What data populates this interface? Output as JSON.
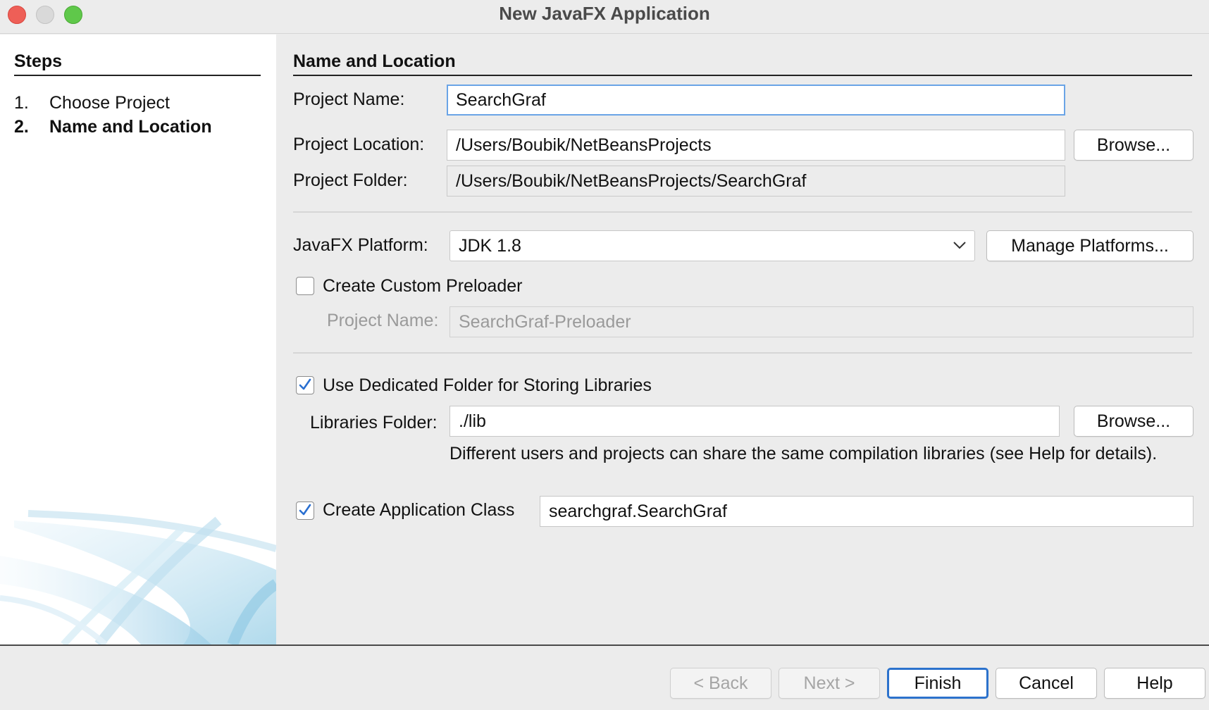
{
  "window": {
    "title": "New JavaFX Application"
  },
  "steps": {
    "heading": "Steps",
    "items": [
      {
        "num": "1.",
        "label": "Choose Project"
      },
      {
        "num": "2.",
        "label": "Name and Location"
      }
    ],
    "current": 2
  },
  "section": {
    "title": "Name and Location"
  },
  "project": {
    "name_label": "Project Name:",
    "name_value": "SearchGraf",
    "location_label": "Project Location:",
    "location_value": "/Users/Boubik/NetBeansProjects",
    "location_browse": "Browse...",
    "folder_label": "Project Folder:",
    "folder_value": "/Users/Boubik/NetBeansProjects/SearchGraf"
  },
  "platform": {
    "label": "JavaFX Platform:",
    "selected": "JDK 1.8",
    "manage_button": "Manage Platforms..."
  },
  "preloader": {
    "checkbox_label": "Create Custom Preloader",
    "checked": false,
    "name_label": "Project Name:",
    "name_value": "SearchGraf-Preloader"
  },
  "libraries": {
    "checkbox_label": "Use Dedicated Folder for Storing Libraries",
    "checked": true,
    "folder_label": "Libraries Folder:",
    "folder_value": "./lib",
    "browse": "Browse...",
    "hint": "Different users and projects can share the same compilation libraries (see Help for details)."
  },
  "app_class": {
    "checkbox_label": "Create Application Class",
    "checked": true,
    "value": "searchgraf.SearchGraf"
  },
  "footer": {
    "back": "< Back",
    "next": "Next >",
    "finish": "Finish",
    "cancel": "Cancel",
    "help": "Help"
  },
  "colors": {
    "accent": "#2c72cc",
    "focus_ring": "#6aa4e6",
    "checkbox_check": "#2a6fd0",
    "close": "#ee5f57",
    "minimize": "#d9d9d9",
    "maximize": "#5fc84a"
  }
}
